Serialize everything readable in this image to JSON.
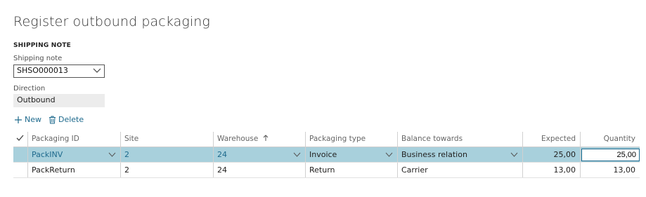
{
  "page": {
    "title": "Register outbound packaging",
    "section_heading": "SHIPPING NOTE"
  },
  "shipping_note": {
    "label": "Shipping note",
    "value": "SHSO000013"
  },
  "direction": {
    "label": "Direction",
    "value": "Outbound"
  },
  "actions": {
    "new_label": "New",
    "delete_label": "Delete"
  },
  "grid": {
    "columns": {
      "packaging_id": "Packaging ID",
      "site": "Site",
      "warehouse": "Warehouse",
      "warehouse_sort_icon": "arrow-up-icon",
      "packaging_type": "Packaging type",
      "balance_towards": "Balance towards",
      "expected": "Expected",
      "quantity": "Quantity"
    },
    "rows": [
      {
        "packaging_id": "PackINV",
        "site": "2",
        "warehouse": "24",
        "packaging_type": "Invoice",
        "balance_towards": "Business relation",
        "expected": "25,00",
        "quantity": "25,00"
      },
      {
        "packaging_id": "PackReturn",
        "site": "2",
        "warehouse": "24",
        "packaging_type": "Return",
        "balance_towards": "Carrier",
        "expected": "13,00",
        "quantity": "13,00"
      }
    ]
  },
  "colors": {
    "accent": "#1e6a8d",
    "selected_row": "#a8d0dc",
    "readonly_bg": "#ececec"
  }
}
